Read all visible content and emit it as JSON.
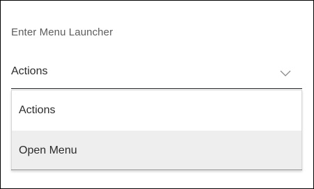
{
  "launcher": {
    "label": "Enter Menu Launcher",
    "selected_value": "Actions",
    "toggle_icon": "chevron-down-icon"
  },
  "dropdown": {
    "options": [
      {
        "label": "Actions"
      },
      {
        "label": "Open Menu",
        "highlighted": true
      }
    ]
  },
  "colors": {
    "label_text": "#5c5c5c",
    "value_text": "#2b2b2b",
    "highlight_bg": "#eeeeee",
    "frame_border": "#000000"
  }
}
